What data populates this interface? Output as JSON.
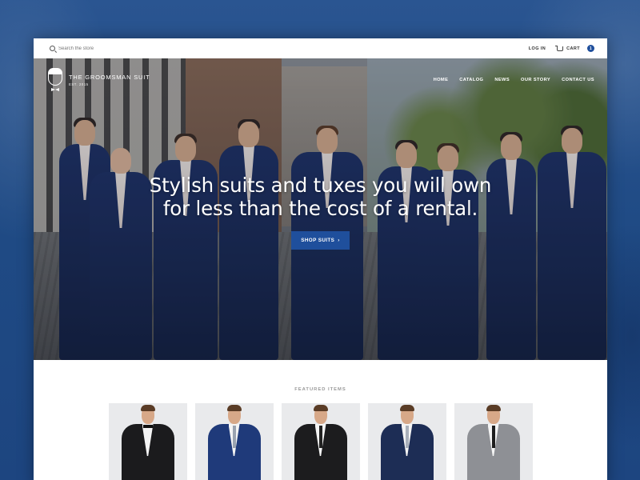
{
  "topbar": {
    "search_placeholder": "Search the store",
    "login_label": "LOG IN",
    "cart_label": "CART",
    "cart_count": "1"
  },
  "brand": {
    "name": "THE GROOMSMAN SUIT",
    "established": "EST. 2015"
  },
  "nav": {
    "items": [
      {
        "label": "HOME"
      },
      {
        "label": "CATALOG"
      },
      {
        "label": "NEWS"
      },
      {
        "label": "OUR STORY"
      },
      {
        "label": "CONTACT US"
      }
    ]
  },
  "hero": {
    "headline_line1": "Stylish suits and tuxes you will own",
    "headline_line2": "for less than the cost of a rental.",
    "cta_label": "SHOP SUITS",
    "cta_chevron": "›"
  },
  "featured": {
    "title": "FEATURED ITEMS",
    "products": [
      {
        "suit_color": "#1b1b1d",
        "tie_color": "#111111",
        "tie_style": "bow-tie"
      },
      {
        "suit_color": "#1f3a7a",
        "tie_color": "#9aa3b0",
        "tie_style": "tie"
      },
      {
        "suit_color": "#1c1c1e",
        "tie_color": "#222222",
        "tie_style": "tie"
      },
      {
        "suit_color": "#1d2d55",
        "tie_color": "#a9b0ba",
        "tie_style": "tie"
      },
      {
        "suit_color": "#8e9095",
        "tie_color": "#1e1e1e",
        "tie_style": "tie"
      }
    ]
  },
  "colors": {
    "accent": "#1f4f9c",
    "backdrop": "#234d86"
  }
}
